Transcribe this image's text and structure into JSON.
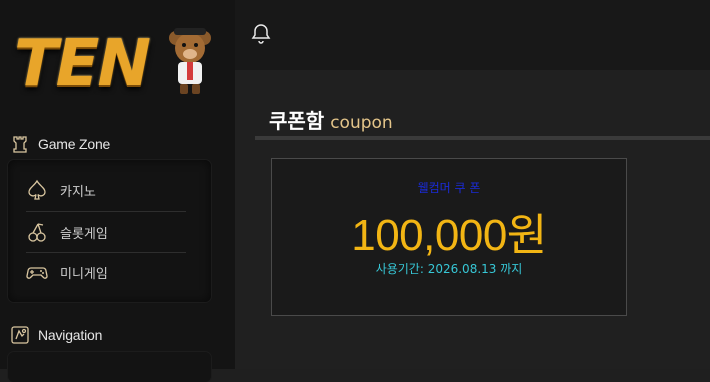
{
  "brand": {
    "logo_text": "TEN",
    "logo_color": "#e8a52a"
  },
  "sidebar": {
    "game_zone": {
      "heading": "Game Zone",
      "icon": "chess-rook-icon",
      "items": [
        {
          "label": "카지노",
          "icon": "spade-icon"
        },
        {
          "label": "슬롯게임",
          "icon": "cherry-icon"
        },
        {
          "label": "미니게임",
          "icon": "gamepad-icon"
        }
      ]
    },
    "navigation": {
      "heading": "Navigation",
      "icon": "navigation-icon"
    }
  },
  "topbar": {
    "bell_icon": "bell-icon"
  },
  "page": {
    "title": "쿠폰함",
    "subtitle": "coupon"
  },
  "coupon": {
    "name": "웰컴머 쿠 폰",
    "amount": "100,000원",
    "period": "사용기간: 2026.08.13 까지",
    "colors": {
      "name": "#1a2bd6",
      "amount": "#f2b514",
      "period": "#37c7d6"
    }
  }
}
